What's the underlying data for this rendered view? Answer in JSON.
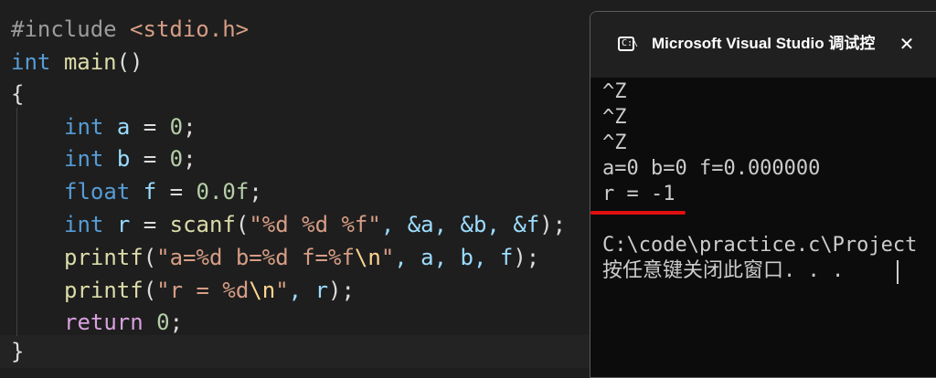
{
  "editor": {
    "include": {
      "directive": "#include",
      "header": "<stdio.h>"
    },
    "main_sig": {
      "type": "int",
      "name": "main",
      "parens": "()"
    },
    "open_brace": "{",
    "line_a": {
      "type": "int",
      "var": "a",
      "eq": " = ",
      "val": "0",
      "end": ";"
    },
    "line_b": {
      "type": "int",
      "var": "b",
      "eq": " = ",
      "val": "0",
      "end": ";"
    },
    "line_f": {
      "type": "float",
      "var": "f",
      "eq": " = ",
      "val": "0.0f",
      "end": ";"
    },
    "line_r": {
      "type": "int",
      "var": "r",
      "eq": " = ",
      "fn": "scanf",
      "open": "(",
      "fmt": "\"%d %d %f\"",
      "args": ", &a, &b, &f",
      "end": ");"
    },
    "printf1": {
      "fn": "printf",
      "open": "(",
      "fmt_start": "\"a=%d b=%d f=%f",
      "esc": "\\n",
      "fmt_end": "\"",
      "args": ", a, b, f",
      "end": ");"
    },
    "printf2": {
      "fn": "printf",
      "open": "(",
      "fmt_start": "\"r = %d",
      "esc": "\\n",
      "fmt_end": "\"",
      "args": ", r",
      "end": ");"
    },
    "return_line": {
      "kw": "return",
      "val": "0",
      "end": ";"
    },
    "close_brace": "}"
  },
  "console": {
    "title": "Microsoft Visual Studio 调试控",
    "close_label": "✕",
    "lines": [
      "^Z",
      "^Z",
      "^Z",
      "a=0 b=0 f=0.000000",
      "r = -1",
      "",
      "C:\\code\\practice.c\\Project",
      "按任意键关闭此窗口. . ."
    ],
    "highlight_color": "#e01010"
  },
  "icons": {
    "console_icon": "terminal-icon",
    "close_icon": "close-icon"
  }
}
